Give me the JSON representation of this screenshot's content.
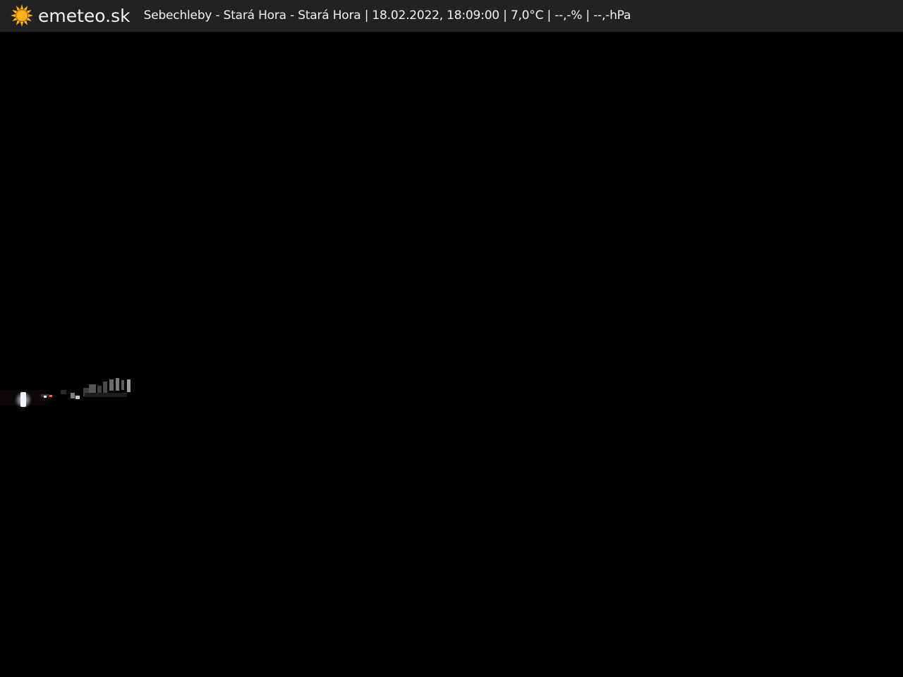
{
  "header": {
    "brand": "emeteo.sk",
    "logo_icon": "sun-icon",
    "caption": "Sebechleby - Stará Hora - Stará Hora | 18.02.2022, 18:09:00 | 7,0°C | --,-% | --,-hPa"
  },
  "colors": {
    "bar_background": "#222222",
    "sun_yellow": "#f7b21b",
    "sun_orange": "#f08a14",
    "image_background": "#000000"
  }
}
